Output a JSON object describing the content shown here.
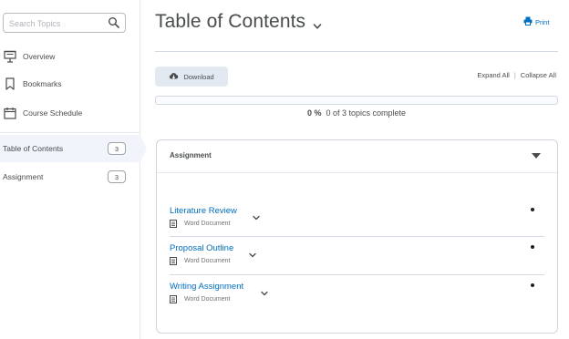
{
  "sidebar": {
    "search": {
      "placeholder": "Search Topics",
      "value": ""
    },
    "nav": [
      {
        "label": "Overview",
        "icon": "presentation-icon"
      },
      {
        "label": "Bookmarks",
        "icon": "bookmark-icon"
      },
      {
        "label": "Course Schedule",
        "icon": "calendar-icon"
      }
    ],
    "toc": [
      {
        "label": "Table of Contents",
        "count": "3",
        "selected": true
      },
      {
        "label": "Assignment",
        "count": "3",
        "selected": false
      }
    ]
  },
  "header": {
    "title": "Table of Contents",
    "print_label": "Print"
  },
  "actions": {
    "download_label": "Download",
    "expand_all": "Expand All",
    "separator": "|",
    "collapse_all": "Collapse All"
  },
  "progress": {
    "percent_label": "0 %",
    "summary": "0 of 3 topics complete",
    "fraction": 0
  },
  "module": {
    "title": "Assignment",
    "topics": [
      {
        "title": "Literature Review",
        "type": "Word Document"
      },
      {
        "title": "Proposal Outline",
        "type": "Word Document"
      },
      {
        "title": "Writing Assignment",
        "type": "Word Document"
      }
    ]
  },
  "colors": {
    "link": "#006fbf",
    "text": "#494c4e",
    "button_bg": "#e3e9f1",
    "selected_bg": "#f1f5fb"
  }
}
